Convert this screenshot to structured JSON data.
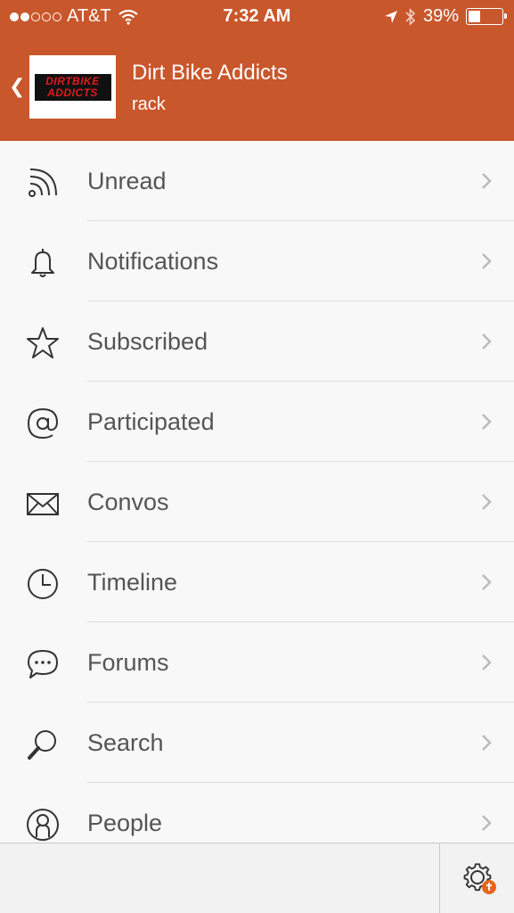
{
  "status_bar": {
    "carrier": "AT&T",
    "time": "7:32 AM",
    "battery": "39%",
    "battery_level": 0.39
  },
  "header": {
    "logo_text_line1": "DIRTBIKE",
    "logo_text_line2": "ADDICTS",
    "title": "Dirt Bike Addicts",
    "subtitle": "rack",
    "back_icon": "chevron-left-icon"
  },
  "menu": {
    "items": [
      {
        "label": "Unread",
        "icon": "rss-icon"
      },
      {
        "label": "Notifications",
        "icon": "bell-icon"
      },
      {
        "label": "Subscribed",
        "icon": "star-icon"
      },
      {
        "label": "Participated",
        "icon": "at-sign-icon"
      },
      {
        "label": "Convos",
        "icon": "envelope-icon"
      },
      {
        "label": "Timeline",
        "icon": "clock-icon"
      },
      {
        "label": "Forums",
        "icon": "chat-bubble-icon"
      },
      {
        "label": "Search",
        "icon": "magnifier-icon"
      },
      {
        "label": "People",
        "icon": "person-icon"
      }
    ]
  },
  "footer": {
    "settings_icon": "gear-icon",
    "badge_icon": "tapatalk-badge-icon"
  },
  "colors": {
    "header_bg": "#c9572c",
    "text": "#555555",
    "badge": "#e8651e"
  }
}
